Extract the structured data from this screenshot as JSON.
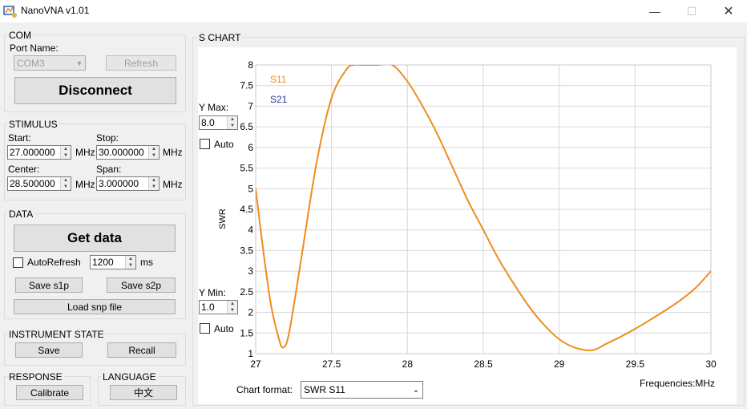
{
  "window": {
    "title": "NanoVNA v1.01",
    "minimize": "—",
    "maximize": "☐",
    "close": "✕"
  },
  "com": {
    "label": "COM",
    "port_name_label": "Port Name:",
    "port_value": "COM3",
    "refresh_label": "Refresh",
    "disconnect_label": "Disconnect"
  },
  "stimulus": {
    "label": "STIMULUS",
    "start_label": "Start:",
    "start_value": "27.000000",
    "stop_label": "Stop:",
    "stop_value": "30.000000",
    "center_label": "Center:",
    "center_value": "28.500000",
    "span_label": "Span:",
    "span_value": "3.000000",
    "unit": "MHz"
  },
  "data_group": {
    "label": "DATA",
    "get_data_label": "Get data",
    "autorefresh_label": "AutoRefresh",
    "autorefresh_value": "1200",
    "autorefresh_unit": "ms",
    "save_s1p_label": "Save s1p",
    "save_s2p_label": "Save s2p",
    "load_snp_label": "Load snp file"
  },
  "instrument_state": {
    "label": "INSTRUMENT STATE",
    "save_label": "Save",
    "recall_label": "Recall"
  },
  "response": {
    "label": "RESPONSE",
    "calibrate_label": "Calibrate"
  },
  "language": {
    "label": "LANGUAGE",
    "button_label": "中文"
  },
  "s_chart": {
    "label": "S CHART",
    "ymax_label": "Y Max:",
    "ymax_value": "8.0",
    "ymax_auto_label": "Auto",
    "ymin_label": "Y Min:",
    "ymin_value": "1.0",
    "ymin_auto_label": "Auto",
    "chart_format_label": "Chart format:",
    "chart_format_value": "SWR S11",
    "freq_unit_label": "Frequencies:MHz"
  },
  "colors": {
    "s11": "#f08c1e",
    "s21": "#2a3a8f",
    "grid": "#d8d8d8"
  },
  "chart_data": {
    "type": "line",
    "xlabel": "Frequencies:MHz",
    "ylabel": "SWR",
    "xlim": [
      27,
      30
    ],
    "ylim": [
      1,
      8
    ],
    "x_ticks": [
      "27",
      "27.5",
      "28",
      "28.5",
      "29",
      "29.5",
      "30"
    ],
    "y_ticks": [
      "1",
      "1.5",
      "2",
      "2.5",
      "3",
      "3.5",
      "4",
      "4.5",
      "5",
      "5.5",
      "6",
      "6.5",
      "7",
      "7.5",
      "8"
    ],
    "series": [
      {
        "name": "S11",
        "color": "#f08c1e",
        "x": [
          27.0,
          27.05,
          27.1,
          27.15,
          27.18,
          27.22,
          27.3,
          27.4,
          27.5,
          27.6,
          27.65,
          27.7,
          27.8,
          27.9,
          28.0,
          28.1,
          28.2,
          28.3,
          28.4,
          28.5,
          28.6,
          28.7,
          28.8,
          28.9,
          29.0,
          29.1,
          29.2,
          29.25,
          29.3,
          29.4,
          29.5,
          29.6,
          29.7,
          29.8,
          29.9,
          30.0
        ],
        "y": [
          5.0,
          3.5,
          2.2,
          1.4,
          1.15,
          1.5,
          3.3,
          5.6,
          7.2,
          7.9,
          8.0,
          8.0,
          8.0,
          8.0,
          7.6,
          7.0,
          6.3,
          5.5,
          4.7,
          4.0,
          3.3,
          2.7,
          2.15,
          1.7,
          1.35,
          1.15,
          1.08,
          1.12,
          1.22,
          1.4,
          1.6,
          1.82,
          2.05,
          2.3,
          2.6,
          3.0
        ]
      },
      {
        "name": "S21",
        "color": "#2a3a8f",
        "x": [],
        "y": []
      }
    ]
  }
}
